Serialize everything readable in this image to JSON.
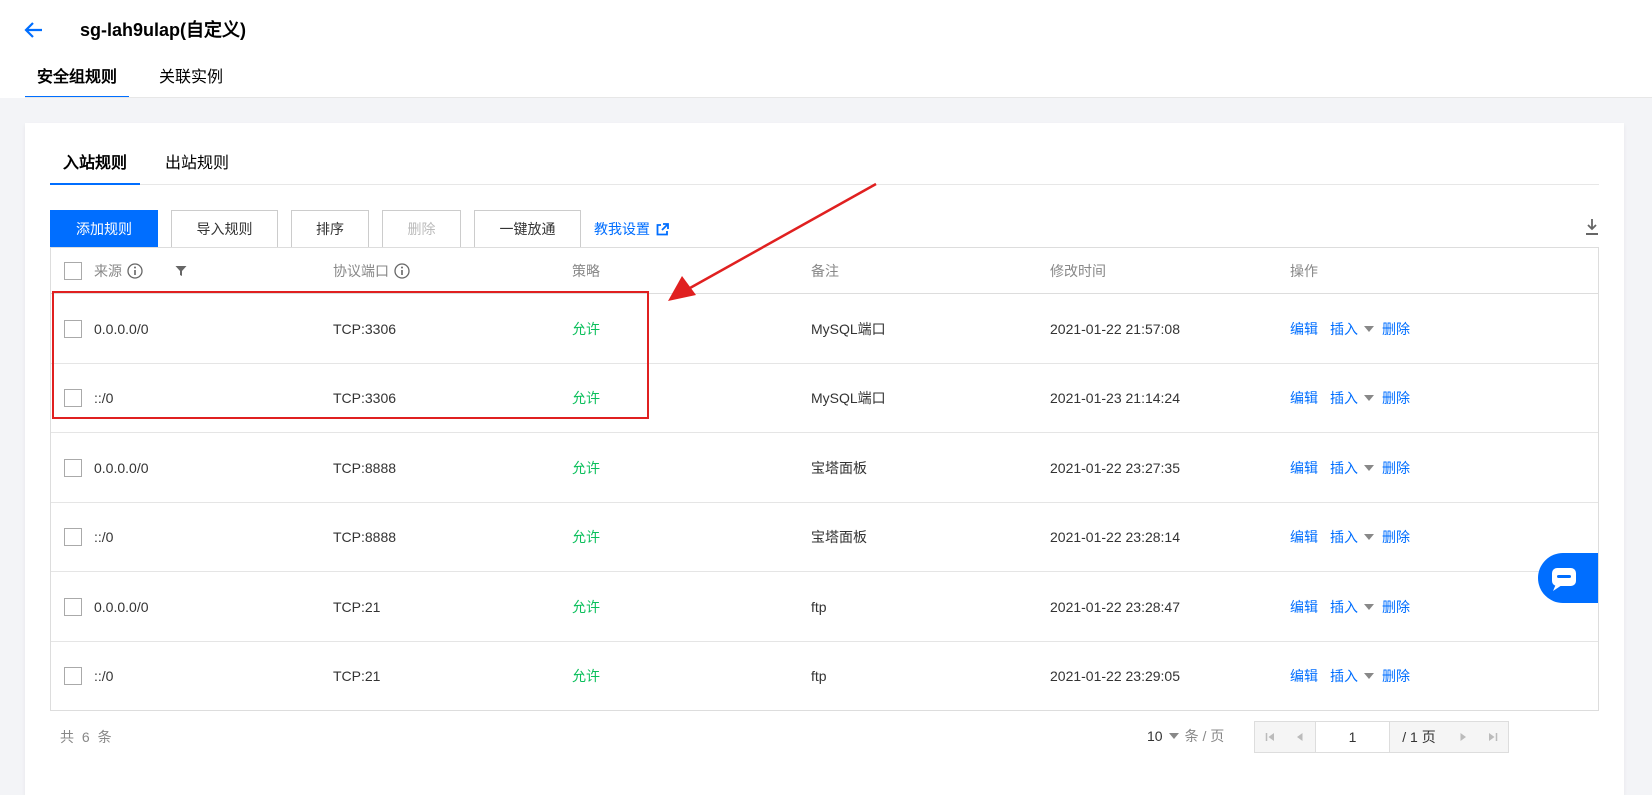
{
  "header": {
    "title": "sg-lah9ulap(自定义)",
    "tabs": [
      {
        "label": "安全组规则",
        "active": true
      },
      {
        "label": "关联实例",
        "active": false
      }
    ]
  },
  "rule_tabs": [
    {
      "label": "入站规则",
      "active": true
    },
    {
      "label": "出站规则",
      "active": false
    }
  ],
  "toolbar": {
    "add_label": "添加规则",
    "import_label": "导入规则",
    "sort_label": "排序",
    "delete_label": "删除",
    "open_all_label": "一键放通",
    "help_label": "教我设置"
  },
  "table": {
    "columns": {
      "source": "来源",
      "protocol_port": "协议端口",
      "policy": "策略",
      "note": "备注",
      "modified": "修改时间",
      "actions": "操作"
    },
    "rows": [
      {
        "source": "0.0.0.0/0",
        "port": "TCP:3306",
        "policy": "允许",
        "note": "MySQL端口",
        "modified": "2021-01-22 21:57:08"
      },
      {
        "source": "::/0",
        "port": "TCP:3306",
        "policy": "允许",
        "note": "MySQL端口",
        "modified": "2021-01-23 21:14:24"
      },
      {
        "source": "0.0.0.0/0",
        "port": "TCP:8888",
        "policy": "允许",
        "note": "宝塔面板",
        "modified": "2021-01-22 23:27:35"
      },
      {
        "source": "::/0",
        "port": "TCP:8888",
        "policy": "允许",
        "note": "宝塔面板",
        "modified": "2021-01-22 23:28:14"
      },
      {
        "source": "0.0.0.0/0",
        "port": "TCP:21",
        "policy": "允许",
        "note": "ftp",
        "modified": "2021-01-22 23:28:47"
      },
      {
        "source": "::/0",
        "port": "TCP:21",
        "policy": "允许",
        "note": "ftp",
        "modified": "2021-01-22 23:29:05"
      }
    ],
    "row_actions": {
      "edit": "编辑",
      "insert": "插入",
      "delete": "删除"
    }
  },
  "pagination": {
    "total": "共 6 条",
    "page_size": "10",
    "per_page_suffix": "条 / 页",
    "current_page": "1",
    "total_pages": "/ 1 页"
  },
  "colors": {
    "primary": "#006eff",
    "allow": "#0abf5b",
    "annotation": "#e02020"
  }
}
